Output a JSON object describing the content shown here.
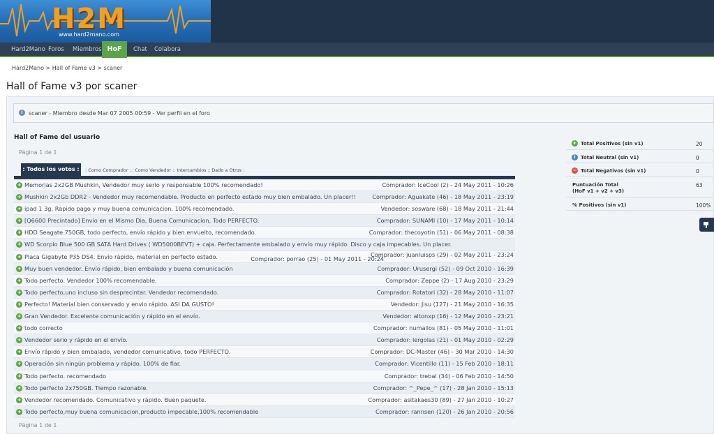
{
  "header": {
    "logo_text": "H2M",
    "logo_url": "www.hard2mano.com"
  },
  "nav": {
    "items": [
      "Hard2Mano",
      "Foros",
      "Miembros",
      "HoF",
      "Chat",
      "Colabora"
    ],
    "active": "HoF"
  },
  "breadcrumb": "Hard2Mano  >  Hall of Fame v3  >  scaner",
  "page_title": "Hall of Fame v3 por scaner",
  "member_info": "scaner - Miembro desde Mar 07 2005 00:59 - Ver perfil en el foro",
  "section_title": "Hall of Fame del usuario",
  "pager_text": "Página 1 de 1",
  "tabs": {
    "active": ": Todos los votos :",
    "others": [
      ": Como Comprador :",
      ": Como Vendedor :",
      ": Intercambios :",
      ": Dado a Otros :"
    ]
  },
  "votes": [
    {
      "comment": "Memorias 2x2GB Mushkin, Vendedor muy serio y responsable 100% recomendado!",
      "meta": "Comprador: IceCool (2) - 24 May 2011 - 10:26"
    },
    {
      "comment": "Mushkin 2x2Gb DDR2 - Vendedor muy recomendable. Producto en perfecto estado muy bien embalado. Un placer!!",
      "meta": "Comprador: Aguakate (46) - 18 May 2011 - 23:19"
    },
    {
      "comment": "ipad 1 3g. Rapido pago y muy buena comunicacion. 100% recomendado.",
      "meta": "Vendedor: sosware (68) - 18 May 2011 - 21:44"
    },
    {
      "comment": "[Q6600 Precintado] Envio en el Mismo Dia, Buena Comunicacion, Todo PERFECTO.",
      "meta": "Comprador: SUNAMI (10) - 17 May 2011 - 10:14"
    },
    {
      "comment": "HDD Seagate 750GB, todo perfecto, envío rápido y bien envuelto, recomendado.",
      "meta": "Comprador: thecoyotin (51) - 06 May 2011 - 08:38"
    },
    {
      "comment": "WD Scorpio Blue 500 GB SATA Hard Drives ( WD5000BEVT) + caja. Perfectamente embalado y envío muy rápido. Disco y caja impecables. Un placer.",
      "meta": ""
    },
    {
      "comment": "Placa Gigabyte P35 DS4. Envío rápido, material en perfecto estado.",
      "meta": "Comprador: juanluisps (29) - 02 May 2011 - 23:24",
      "meta2": "Comprador: porrao (25) - 01 May 2011 - 20:24"
    },
    {
      "comment": "Muy buen vendedor. Envío rápido, bien embalado y buena comunicación",
      "meta": "Comprador: Urusergi (52) - 09 Oct 2010 - 16:39"
    },
    {
      "comment": "Todo perfecto. Vendedor 100% recomendable.",
      "meta": "Comprador: Zeppe (2) - 17 Aug 2010 - 23:29"
    },
    {
      "comment": "Todo perfecto,uno incluso sin desprecintar. Vendedor recomendado.",
      "meta": "Comprador: Rotatori (32) - 28 May 2010 - 11:07"
    },
    {
      "comment": "Perfecto! Material bien conservado y envio rápido. ASI DA GUSTO!",
      "meta": "Vendedor: Jisu (127) - 21 May 2010 - 16:35"
    },
    {
      "comment": "Gran Vendedor. Excelente comunicación y rápido en el envío.",
      "meta": "Vendedor: altonxp (16) - 12 May 2010 - 23:21"
    },
    {
      "comment": "todo correcto",
      "meta": "Comprador: numallos (81) - 05 May 2010 - 11:01"
    },
    {
      "comment": "Vendedor serio y rápido en el envío.",
      "meta": "Comprador: lergolas (21) - 01 May 2010 - 02:29"
    },
    {
      "comment": "Envío rápido y bien embalado, vendedor comunicativo, todo PERFECTO.",
      "meta": "Comprador: DC-Master (46) - 30 Mar 2010 - 14:30"
    },
    {
      "comment": "Operación sin ningún problema y rápido. 100% de fiar.",
      "meta": "Comprador: Vicentillo (11) - 15 Feb 2010 - 18:11"
    },
    {
      "comment": "Todo perfecto. recomendado",
      "meta": "Comprador: trebal (34) - 06 Feb 2010 - 14:50"
    },
    {
      "comment": "Todo perfecto 2x750GB. Tiempo razonable.",
      "meta": "Comprador: ^_Pepe_^ (17) - 28 Jan 2010 - 15:13"
    },
    {
      "comment": "Vendedor recomendado. Comunicativo y rápido. Buen paquete.",
      "meta": "Comprador: asitakaes30 (89) - 27 Jan 2010 - 10:27"
    },
    {
      "comment": "Todo perfecto,muy buena comunicacion,producto impecable,100% recomendable",
      "meta": "Comprador: rannsen (120) - 26 Jan 2010 - 20:56"
    }
  ],
  "stats": {
    "positives_label": "Total Positivos (sin v1)",
    "positives_value": "20",
    "neutral_label": "Total Neutral (sin v1)",
    "neutral_value": "0",
    "negatives_label": "Total Negativos (sin v1)",
    "negatives_value": "0",
    "score_label": "Puntuación Total",
    "score_sublabel": "(HoF v1 + v2 + v3)",
    "score_value": "63",
    "percent_label": "% Positivos (sin v1)",
    "percent_value": "100%"
  },
  "colors": {
    "header_bg": "#213349",
    "nav_bg": "#2e4055",
    "active_tab": "#5aa547",
    "positive": "#58a83d",
    "neutral": "#4a86c5",
    "negative": "#d9534f"
  },
  "icons": {
    "positive": "plus-circle-icon",
    "neutral": "info-circle-icon",
    "negative": "minus-circle-icon"
  }
}
